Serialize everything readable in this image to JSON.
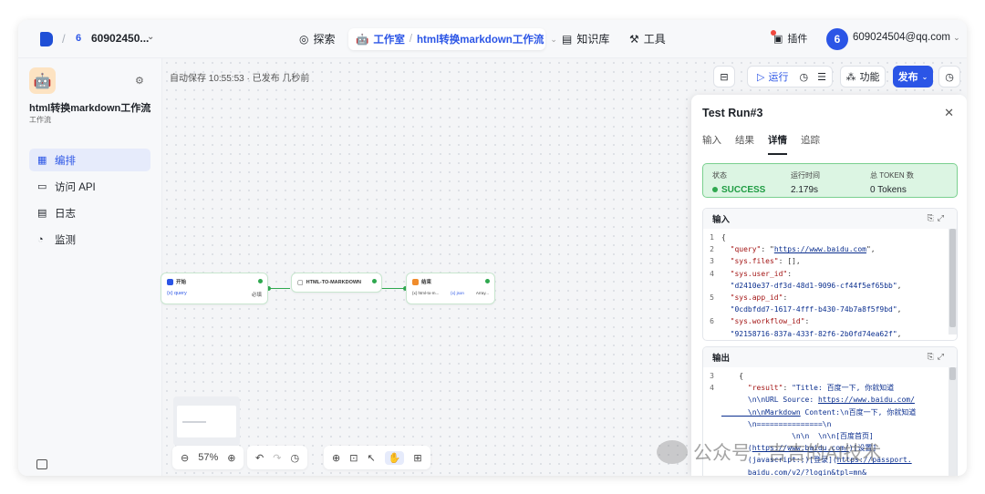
{
  "topbar": {
    "workspace_num": "6",
    "workspace_name": "60902450...",
    "nav": {
      "explore": "探索",
      "studio": "工作室",
      "workflow_crumb": "html转换markdown工作流",
      "knowledge": "知识库",
      "tools": "工具",
      "plugins": "插件"
    },
    "avatar_initial": "6",
    "email": "609024504@qq.com"
  },
  "sidebar": {
    "workflow_title": "html转换markdown工作流",
    "workflow_sub": "工作流",
    "items": [
      {
        "label": "编排",
        "icon": "layout-icon",
        "active": true
      },
      {
        "label": "访问 API",
        "icon": "terminal-icon",
        "active": false
      },
      {
        "label": "日志",
        "icon": "log-icon",
        "active": false
      },
      {
        "label": "监测",
        "icon": "monitor-icon",
        "active": false
      }
    ]
  },
  "canvas": {
    "autosave": "自动保存 10:55:53 · 已发布 几秒前",
    "toolbar": {
      "run": "运行",
      "features": "功能",
      "publish": "发布"
    },
    "nodes": {
      "start": {
        "title": "开始",
        "var": "{x} query",
        "req": "必填"
      },
      "middle": {
        "title": "HTML-TO-MARKDOWN"
      },
      "end": {
        "title": "结束",
        "var1": "{x} html-to-m...",
        "var2": "{x} json",
        "var3": "Array..."
      }
    },
    "zoom": "57%"
  },
  "panel": {
    "title": "Test Run#3",
    "tabs": [
      "输入",
      "结果",
      "详情",
      "追踪"
    ],
    "active_tab": "详情",
    "status_label": "状态",
    "status_value": "SUCCESS",
    "runtime_label": "运行时间",
    "runtime_value": "2.179s",
    "tokens_label": "总 TOKEN 数",
    "tokens_value": "0 Tokens",
    "input_title": "输入",
    "output_title": "输出"
  },
  "watermark": "公众号 · 吉吉的AI技术",
  "colors": {
    "accent": "#2b55e6",
    "success": "#2fa84f",
    "success_bg": "#dcf5e3"
  }
}
